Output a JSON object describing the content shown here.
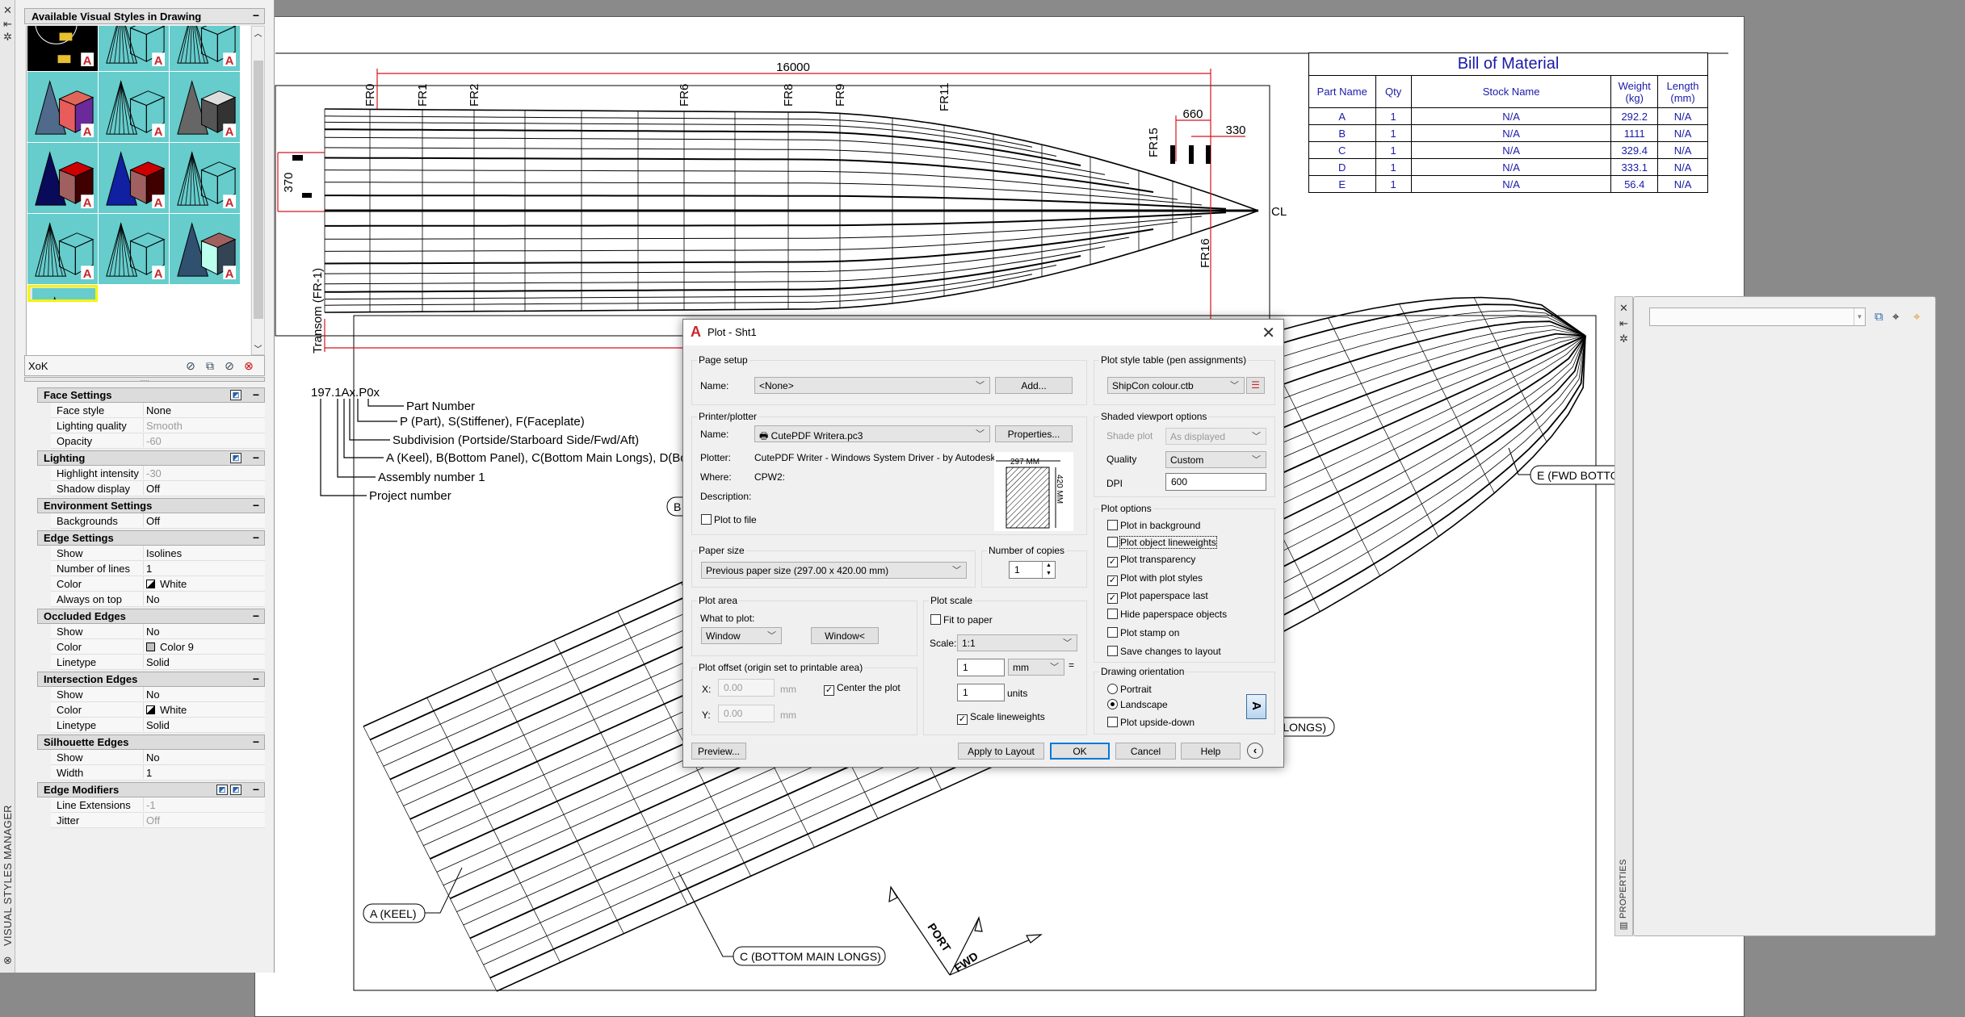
{
  "colors": {
    "accent": "#0078d7",
    "dimension": "#d4161d",
    "bom_text": "#1a1aa8",
    "thumb_bg": "#66cccc",
    "selected_thumb": "#f5f500",
    "autocad_red": "#c8262b"
  },
  "palette": {
    "title": "Available Visual Styles in Drawing",
    "side_label": "VISUAL STYLES MANAGER",
    "current_style": "XoK",
    "thumbnails": [
      "2d-wireframe",
      "wireframe",
      "wireframe",
      "conceptual",
      "hidden",
      "shades-of-gray",
      "realistic",
      "shaded",
      "wireframe",
      "sketchy",
      "wireframe",
      "x-ray",
      "current-custom"
    ],
    "selected_index": 12,
    "tool_icons": [
      "create-style-icon",
      "apply-to-viewport-icon",
      "export-to-palette-icon",
      "delete-style-icon"
    ],
    "sections": [
      {
        "title": "Face Settings",
        "icons": [
          "face-settings-icon"
        ],
        "rows": [
          {
            "label": "Face style",
            "value": "None"
          },
          {
            "label": "Lighting quality",
            "value": "Smooth",
            "muted": true
          },
          {
            "label": "Opacity",
            "value": "-60",
            "muted": true
          }
        ]
      },
      {
        "title": "Lighting",
        "icons": [
          "lighting-icon"
        ],
        "rows": [
          {
            "label": "Highlight intensity",
            "value": "-30",
            "muted": true
          },
          {
            "label": "Shadow display",
            "value": "Off"
          }
        ]
      },
      {
        "title": "Environment Settings",
        "icons": [],
        "rows": [
          {
            "label": "Backgrounds",
            "value": "Off"
          }
        ]
      },
      {
        "title": "Edge Settings",
        "icons": [],
        "rows": [
          {
            "label": "Show",
            "value": "Isolines"
          },
          {
            "label": "Number of lines",
            "value": "1"
          },
          {
            "label": "Color",
            "value": "White",
            "swatch": "white"
          },
          {
            "label": "Always on top",
            "value": "No"
          }
        ]
      },
      {
        "title": "Occluded Edges",
        "icons": [],
        "rows": [
          {
            "label": "Show",
            "value": "No"
          },
          {
            "label": "Color",
            "value": "Color 9",
            "swatch": "gray"
          },
          {
            "label": "Linetype",
            "value": "Solid"
          }
        ]
      },
      {
        "title": "Intersection Edges",
        "icons": [],
        "rows": [
          {
            "label": "Show",
            "value": "No"
          },
          {
            "label": "Color",
            "value": "White",
            "swatch": "white"
          },
          {
            "label": "Linetype",
            "value": "Solid"
          }
        ]
      },
      {
        "title": "Silhouette Edges",
        "icons": [],
        "rows": [
          {
            "label": "Show",
            "value": "No"
          },
          {
            "label": "Width",
            "value": "1"
          }
        ]
      },
      {
        "title": "Edge Modifiers",
        "icons": [
          "line-extensions-icon",
          "jitter-icon"
        ],
        "rows": [
          {
            "label": "Line Extensions",
            "value": "-1",
            "muted": true
          },
          {
            "label": "Jitter",
            "value": "Off",
            "muted": true
          }
        ]
      }
    ]
  },
  "properties_panel": {
    "side_label": "PROPERTIES",
    "selection_value": "",
    "icons": [
      "quick-select-icon",
      "select-objects-icon",
      "toggle-pickadd-icon"
    ]
  },
  "drawing": {
    "overall_length": "16000",
    "frames": [
      "FR0",
      "FR1",
      "FR2",
      "FR6",
      "FR8",
      "FR9",
      "FR11"
    ],
    "fr15": "FR15",
    "fr16": "FR16",
    "dim_660": "660",
    "dim_330": "330",
    "dim_370": "370",
    "centerline": "CL",
    "transom": "Transom (FR-1)",
    "naming": {
      "code": "197.1Ax.P0x",
      "lines": [
        "Part Number",
        "P (Part), S(Stiffener), F(Faceplate)",
        "Subdivision (Portside/Starboard Side/Fwd/Aft)",
        "A (Keel), B(Bottom Panel), C(Bottom Main Longs), D(Botto",
        "Assembly number 1",
        "Project number"
      ]
    },
    "callouts": {
      "a": "A (KEEL)",
      "b": "B",
      "c": "C (BOTTOM MAIN LONGS)",
      "d": "LONGS)",
      "e": "E (FWD BOTTO"
    },
    "compass": {
      "port": "PORT",
      "fwd": "FWD"
    }
  },
  "bom": {
    "title": "Bill of Material",
    "headers": [
      "Part Name",
      "Qty",
      "Stock Name",
      "Weight (kg)",
      "Length (mm)"
    ],
    "rows": [
      [
        "A",
        "1",
        "N/A",
        "292.2",
        "N/A"
      ],
      [
        "B",
        "1",
        "N/A",
        "1111",
        "N/A"
      ],
      [
        "C",
        "1",
        "N/A",
        "329.4",
        "N/A"
      ],
      [
        "D",
        "1",
        "N/A",
        "333.1",
        "N/A"
      ],
      [
        "E",
        "1",
        "N/A",
        "56.4",
        "N/A"
      ]
    ]
  },
  "plot_dialog": {
    "title": "Plot - Sht1",
    "page_setup": {
      "label": "Page setup",
      "name_label": "Name:",
      "name_value": "<None>",
      "add_button": "Add..."
    },
    "printer": {
      "label": "Printer/plotter",
      "name_label": "Name:",
      "name_value": "CutePDF Writera.pc3",
      "properties_button": "Properties...",
      "plotter_label": "Plotter:",
      "plotter_value": "CutePDF Writer - Windows System Driver - by Autodesk",
      "where_label": "Where:",
      "where_value": "CPW2:",
      "description_label": "Description:",
      "plot_to_file": "Plot to file",
      "plot_to_file_checked": false,
      "paper_width": "297 MM",
      "paper_height": "420 MM"
    },
    "paper_size": {
      "label": "Paper size",
      "value": "Previous paper size  (297.00 x 420.00 mm)"
    },
    "copies": {
      "label": "Number of copies",
      "value": "1"
    },
    "plot_area": {
      "label": "Plot area",
      "what_label": "What to plot:",
      "what_value": "Window",
      "window_button": "Window<"
    },
    "plot_offset": {
      "label": "Plot offset (origin set to printable area)",
      "x_label": "X:",
      "x_value": "0.00",
      "y_label": "Y:",
      "y_value": "0.00",
      "unit": "mm",
      "center_label": "Center the plot",
      "center_checked": true
    },
    "plot_scale": {
      "label": "Plot scale",
      "fit_label": "Fit to paper",
      "fit_checked": false,
      "scale_label": "Scale:",
      "scale_value": "1:1",
      "paper_units": "1",
      "unit_value": "mm",
      "equals": "=",
      "drawing_units": "1",
      "units_label": "units",
      "lineweights_label": "Scale lineweights",
      "lineweights_checked": true
    },
    "plot_style": {
      "label": "Plot style table (pen assignments)",
      "value": "ShipCon colour.ctb"
    },
    "shaded": {
      "label": "Shaded viewport options",
      "shade_label": "Shade plot",
      "shade_value": "As displayed",
      "quality_label": "Quality",
      "quality_value": "Custom",
      "dpi_label": "DPI",
      "dpi_value": "600"
    },
    "plot_options": {
      "label": "Plot options",
      "items": [
        {
          "label": "Plot in background",
          "checked": false
        },
        {
          "label": "Plot object lineweights",
          "checked": false
        },
        {
          "label": "Plot transparency",
          "checked": true
        },
        {
          "label": "Plot with plot styles",
          "checked": true
        },
        {
          "label": "Plot paperspace last",
          "checked": true
        },
        {
          "label": "Hide paperspace objects",
          "checked": false
        },
        {
          "label": "Plot stamp on",
          "checked": false
        },
        {
          "label": "Save changes to layout",
          "checked": false
        }
      ]
    },
    "orientation": {
      "label": "Drawing orientation",
      "portrait": "Portrait",
      "landscape": "Landscape",
      "selected": "Landscape",
      "upside_down": "Plot upside-down",
      "upside_down_checked": false,
      "icon_letter": "A"
    },
    "buttons": {
      "preview": "Preview...",
      "apply": "Apply to Layout",
      "ok": "OK",
      "cancel": "Cancel",
      "help": "Help"
    }
  }
}
